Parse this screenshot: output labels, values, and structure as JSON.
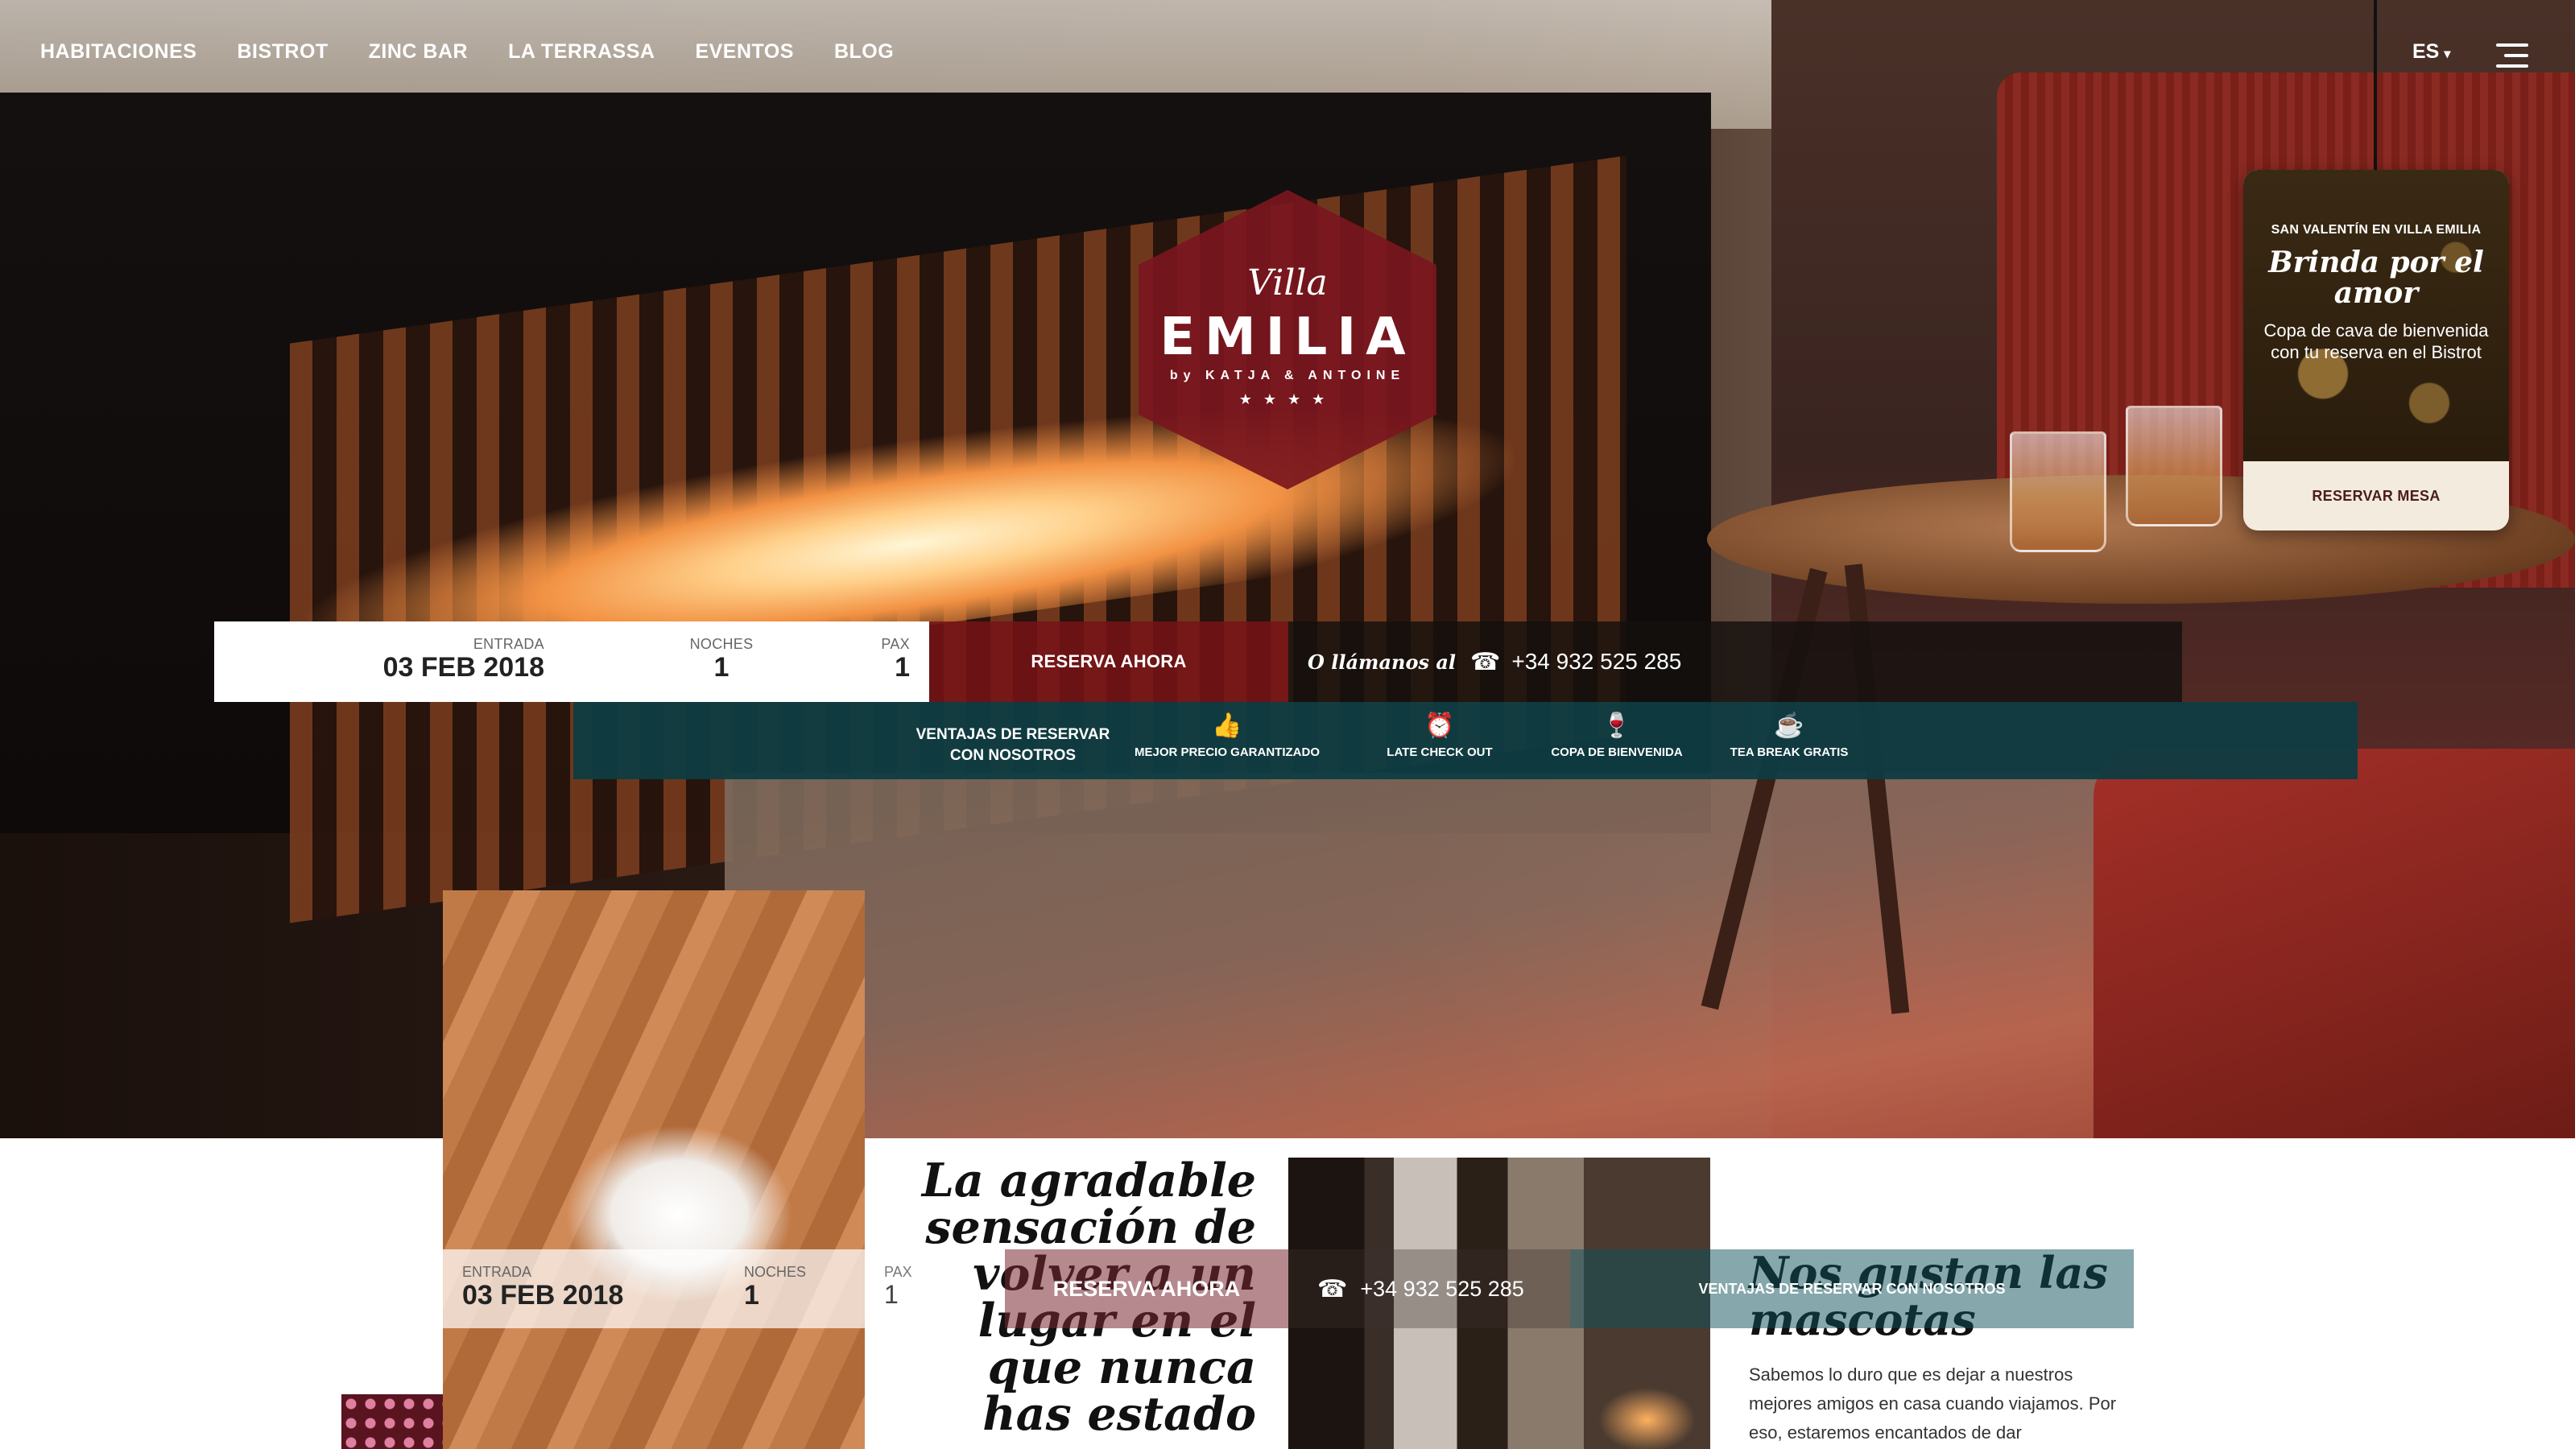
{
  "nav": {
    "items": [
      "HABITACIONES",
      "BISTROT",
      "ZINC BAR",
      "LA TERRASSA",
      "EVENTOS",
      "BLOG"
    ],
    "lang": "ES"
  },
  "logo": {
    "villa": "Villa",
    "name": "EMILIA",
    "by": "by KATJA & ANTOINE",
    "stars": "★★★★"
  },
  "promo": {
    "eyebrow": "SAN VALENTÍN EN VILLA EMILIA",
    "title": "Brinda por el amor",
    "text": "Copa de cava de bienvenida con tu reserva en el Bistrot",
    "button": "RESERVAR MESA"
  },
  "booking": {
    "entrada_label": "ENTRADA",
    "entrada_value": "03 FEB 2018",
    "noches_label": "NOCHES",
    "noches_value": "1",
    "pax_label": "PAX",
    "pax_value": "1",
    "reserve_button": "RESERVA AHORA",
    "call_label": "O llámanos al",
    "phone": "+34 932 525 285"
  },
  "advantages": {
    "title": "VENTAJAS DE RESERVAR CON NOSOTROS",
    "items": [
      {
        "icon": "thumbs-up-icon",
        "label": "MEJOR PRECIO GARANTIZADO"
      },
      {
        "icon": "alarm-clock-icon",
        "label": "LATE CHECK OUT"
      },
      {
        "icon": "wine-glass-icon",
        "label": "COPA DE BIENVENIDA"
      },
      {
        "icon": "tea-cup-icon",
        "label": "TEA BREAK GRATIS"
      }
    ]
  },
  "content": {
    "quote": "La agradable sensación de volver a un lugar en el que nunca has estado",
    "pets_title": "Nos gustan las mascotas",
    "pets_text": "Sabemos lo duro que es dejar a nuestros mejores amigos en casa cuando viajamos. Por eso, estaremos encantados de dar"
  },
  "floating_booking": {
    "entrada_label": "ENTRADA",
    "entrada_value": "03 FEB 2018",
    "noches_label": "NOCHES",
    "noches_value": "1",
    "pax_label": "PAX",
    "pax_value": "1",
    "reserve_button": "RESERVA AHORA",
    "phone": "+34 932 525 285",
    "advantages": "VENTAJAS DE RESERVAR CON NOSOTROS"
  },
  "colors": {
    "burgundy": "#7a161e",
    "teal": "#0e3c42",
    "cream": "#f2ebde"
  }
}
